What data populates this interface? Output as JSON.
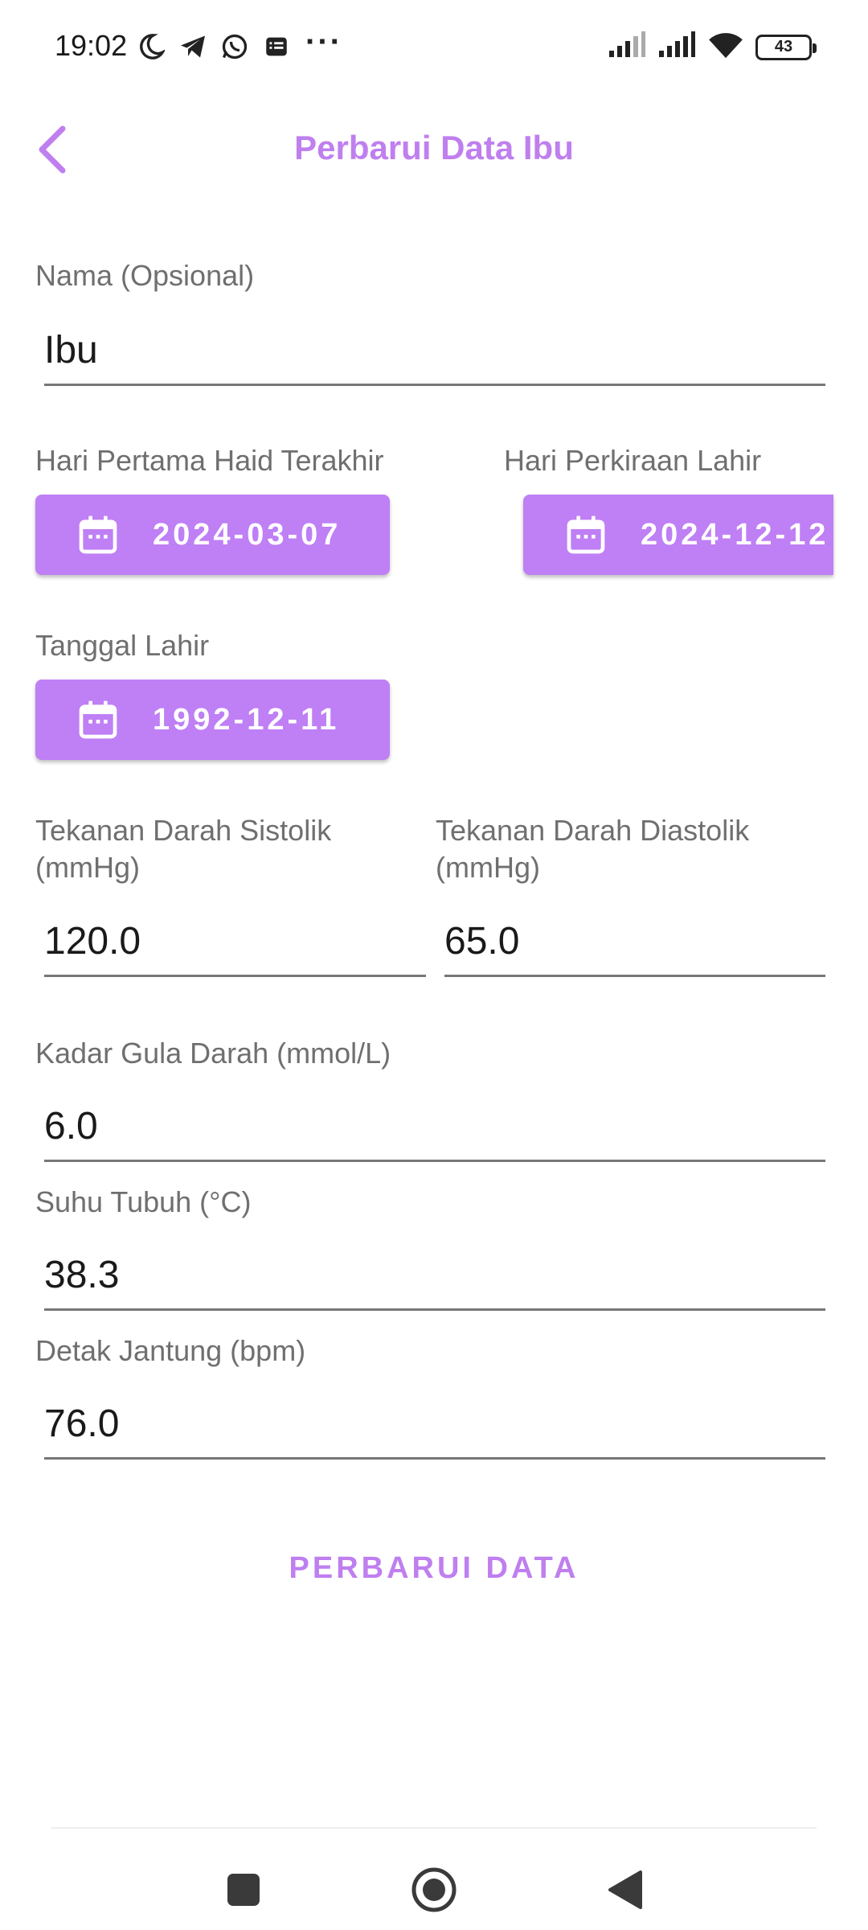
{
  "status_bar": {
    "time": "19:02",
    "battery": "43",
    "icons_left": [
      "moon-icon",
      "telegram-icon",
      "whatsapp-icon",
      "notes-icon"
    ],
    "more": "···"
  },
  "app_bar": {
    "title": "Perbarui Data Ibu",
    "back_icon": "chevron-left-icon",
    "accent_color": "#bf7fef"
  },
  "form": {
    "name": {
      "label": "Nama (Opsional)",
      "value": "Ibu"
    },
    "lmp": {
      "label": "Hari Pertama Haid Terakhir",
      "value": "2024-03-07"
    },
    "edd": {
      "label": "Hari Perkiraan Lahir",
      "value": "2024-12-12"
    },
    "birth_date": {
      "label": "Tanggal Lahir",
      "value": "1992-12-11"
    },
    "systolic": {
      "label": "Tekanan Darah Sistolik (mmHg)",
      "value": "120.0"
    },
    "diastolic": {
      "label": "Tekanan Darah Diastolik (mmHg)",
      "value": "65.0"
    },
    "blood_sugar": {
      "label": "Kadar Gula Darah (mmol/L)",
      "value": "6.0"
    },
    "body_temp": {
      "label": "Suhu Tubuh (°C)",
      "value": "38.3"
    },
    "heart_rate": {
      "label": "Detak Jantung (bpm)",
      "value": "76.0"
    },
    "date_button_color": "#bf7ff5"
  },
  "submit": {
    "label": "PERBARUI DATA"
  },
  "nav_bar": {
    "buttons": [
      "recents-icon",
      "home-icon",
      "back-triangle-icon"
    ]
  }
}
